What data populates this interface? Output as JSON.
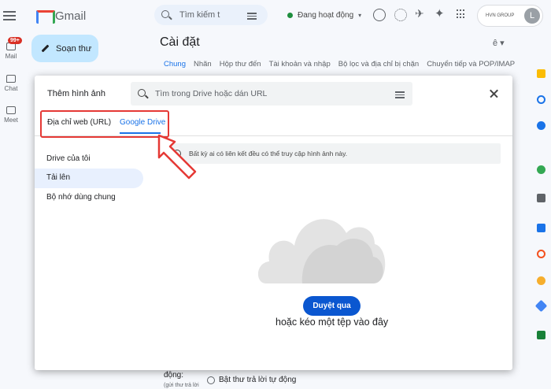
{
  "gmail": {
    "brand": "Gmail",
    "mail_badge": "99+",
    "rail": {
      "mail": "Mail",
      "chat": "Chat",
      "meet": "Meet"
    },
    "search_placeholder": "Tìm kiếm t",
    "status": "Đang hoạt động",
    "account_label": "HVN GROUP",
    "avatar_letter": "L",
    "compose": "Soạn thư"
  },
  "settings": {
    "title": "Cài đặt",
    "lang": "ê",
    "tabs": [
      "Chung",
      "Nhãn",
      "Hộp thư đến",
      "Tài khoản và nhập",
      "Bộ lọc và địa chỉ bị chặn",
      "Chuyển tiếp và POP/IMAP"
    ],
    "bottom_label": "động:",
    "bottom_sub": "(gửi thư trả lời",
    "bottom_option": "Bật thư trả lời tự động"
  },
  "dialog": {
    "title": "Thêm hình ảnh",
    "search_placeholder": "Tìm trong Drive hoặc dán URL",
    "tabs": [
      {
        "label": "Địa chỉ web (URL)",
        "active": false
      },
      {
        "label": "Google Drive",
        "active": true
      }
    ],
    "nav": [
      {
        "label": "Drive của tôi",
        "active": false
      },
      {
        "label": "Tải lên",
        "active": true
      },
      {
        "label": "Bộ nhớ dùng chung",
        "active": false
      }
    ],
    "info": "Bất kỳ ai có liên kết đều có thể truy cập hình ảnh này.",
    "upload_button": "Duyệt qua",
    "drop_text": "hoặc kéo một tệp vào đây"
  },
  "colors": {
    "accent": "#1a73e8",
    "button": "#0b57d0",
    "highlight": "#e53935",
    "compose_bg": "#c2e7ff"
  }
}
